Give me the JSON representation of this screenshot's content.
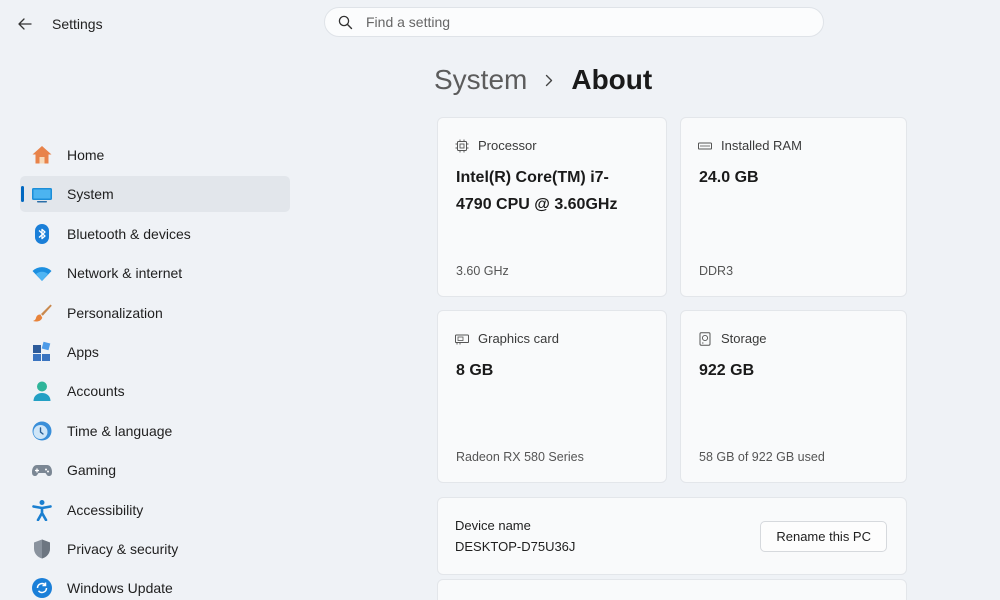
{
  "app": {
    "title": "Settings"
  },
  "search": {
    "placeholder": "Find a setting"
  },
  "sidebar": {
    "items": [
      {
        "label": "Home",
        "icon": "home-icon"
      },
      {
        "label": "System",
        "icon": "system-icon",
        "active": true
      },
      {
        "label": "Bluetooth & devices",
        "icon": "bluetooth-icon"
      },
      {
        "label": "Network & internet",
        "icon": "wifi-icon"
      },
      {
        "label": "Personalization",
        "icon": "brush-icon"
      },
      {
        "label": "Apps",
        "icon": "apps-icon"
      },
      {
        "label": "Accounts",
        "icon": "account-icon"
      },
      {
        "label": "Time & language",
        "icon": "clock-globe-icon"
      },
      {
        "label": "Gaming",
        "icon": "gamepad-icon"
      },
      {
        "label": "Accessibility",
        "icon": "accessibility-icon"
      },
      {
        "label": "Privacy & security",
        "icon": "shield-icon"
      },
      {
        "label": "Windows Update",
        "icon": "update-icon"
      }
    ]
  },
  "breadcrumb": {
    "parent": "System",
    "current": "About"
  },
  "specs": {
    "processor": {
      "title": "Processor",
      "value": "Intel(R) Core(TM) i7-4790 CPU @ 3.60GHz",
      "detail": "3.60 GHz"
    },
    "ram": {
      "title": "Installed RAM",
      "value": "24.0 GB",
      "detail": "DDR3"
    },
    "graphics": {
      "title": "Graphics card",
      "value": "8 GB",
      "detail": "Radeon RX 580 Series"
    },
    "storage": {
      "title": "Storage",
      "value": "922 GB",
      "detail": "58 GB of 922 GB used"
    }
  },
  "device": {
    "label": "Device name",
    "value": "DESKTOP-D75U36J",
    "rename_label": "Rename this PC"
  },
  "colors": {
    "accent": "#0067c0",
    "background": "#eff2f6",
    "card": "#f9fafb"
  }
}
